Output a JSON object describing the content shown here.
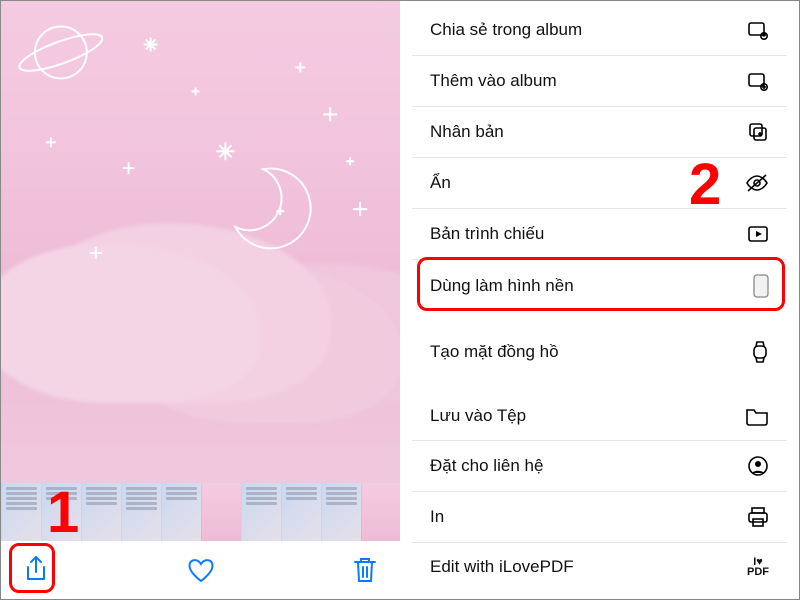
{
  "menu": {
    "group1": [
      {
        "label": "Chia sẻ trong album",
        "iconName": "shared-album-icon"
      },
      {
        "label": "Thêm vào album",
        "iconName": "add-album-icon"
      },
      {
        "label": "Nhân bản",
        "iconName": "duplicate-icon"
      },
      {
        "label": "Ẩn",
        "iconName": "hide-icon"
      },
      {
        "label": "Bản trình chiếu",
        "iconName": "slideshow-icon"
      },
      {
        "label": "Dùng làm hình nền",
        "iconName": "wallpaper-icon"
      }
    ],
    "group2": [
      {
        "label": "Tạo mặt đồng hồ",
        "iconName": "watch-icon"
      }
    ],
    "group3": [
      {
        "label": "Lưu vào Tệp",
        "iconName": "folder-icon"
      },
      {
        "label": "Đặt cho liên hệ",
        "iconName": "contact-icon"
      },
      {
        "label": "In",
        "iconName": "print-icon"
      },
      {
        "label": "Edit with iLovePDF",
        "iconName": "ilovepdf-icon"
      }
    ]
  },
  "annotations": {
    "step1": "1",
    "step2": "2"
  }
}
